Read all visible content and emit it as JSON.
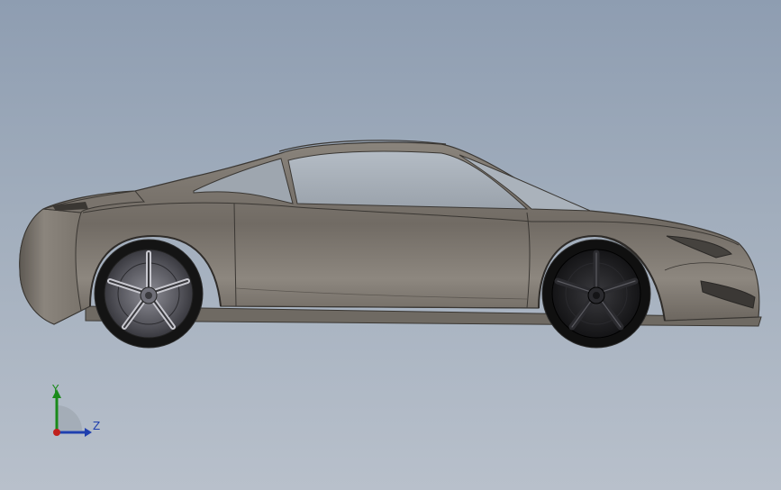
{
  "viewport": {
    "background_top": "#8e9db1",
    "background_bottom": "#b8c0cb"
  },
  "model": {
    "body_color": "#7d776f",
    "edge_color": "#3a3733",
    "glass_color": "#a7afb8",
    "rim_color_rear": "#55555c",
    "rim_color_front": "#1c1c1e",
    "tire_color": "#141414"
  },
  "triad": {
    "y_label": "Y",
    "z_label": "Z",
    "y_color": "#1a8a1a",
    "z_color": "#1f3fae",
    "x_color": "#c0201d"
  }
}
